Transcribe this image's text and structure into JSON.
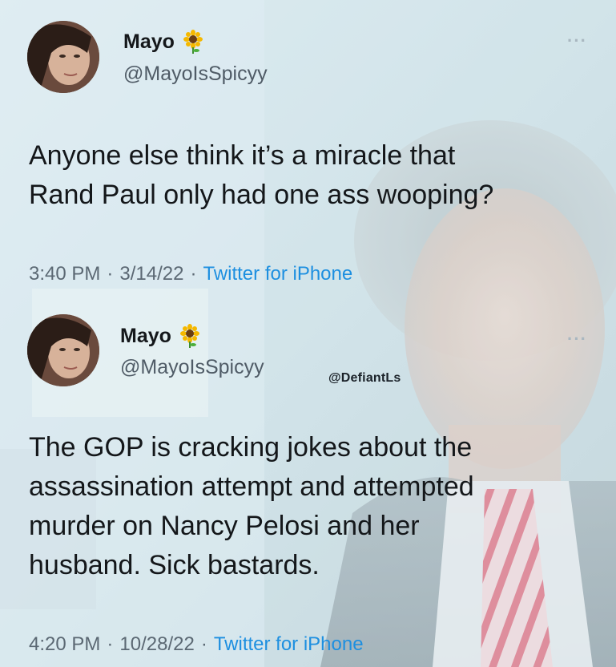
{
  "tweets": [
    {
      "name": "Mayo",
      "handle": "@MayoIsSpicyy",
      "emoji": "sunflower",
      "more": "···",
      "text": "Anyone else think it’s a miracle that\nRand Paul only had one ass wooping?",
      "time": "3:40 PM",
      "date": "3/14/22",
      "source": "Twitter for iPhone",
      "separator": "·"
    },
    {
      "name": "Mayo",
      "handle": "@MayoIsSpicyy",
      "emoji": "sunflower",
      "more": "···",
      "text": "The GOP is cracking jokes about the\nassassination attempt and attempted\nmurder on Nancy Pelosi and her\nhusband. Sick bastards.",
      "time": "4:20 PM",
      "date": "10/28/22",
      "source": "Twitter for iPhone",
      "separator": "·"
    }
  ],
  "watermark": "@DefiantLs",
  "colors": {
    "link": "#1d8fe0",
    "text": "#14171a",
    "meta": "#5b6873"
  }
}
